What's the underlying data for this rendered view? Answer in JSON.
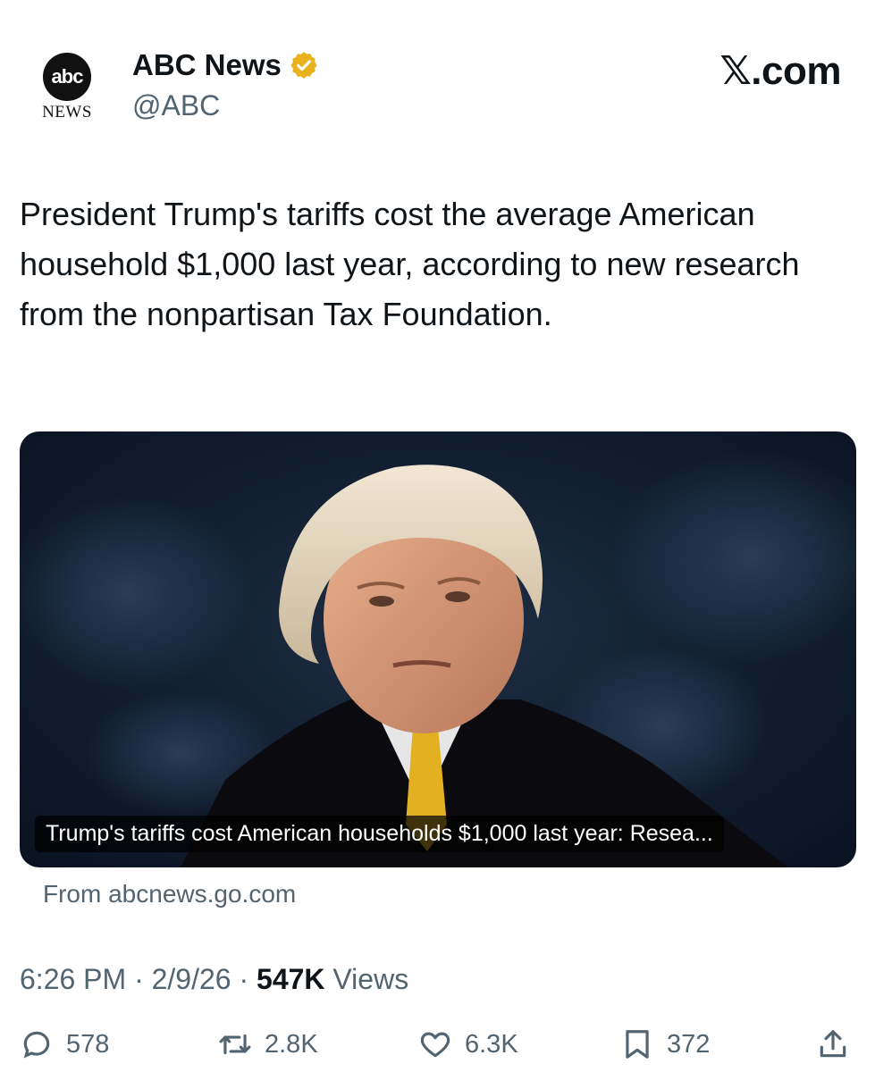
{
  "account": {
    "logo_text": "abc",
    "logo_sub": "NEWS",
    "display_name": "ABC News",
    "handle": "@ABC",
    "verified_color": "#e8b21d"
  },
  "brand": "𝕏.com",
  "tweet": {
    "text": "President Trump's tariffs cost the average American household $1,000 last year, according to new research from the nonpartisan Tax Foundation."
  },
  "card": {
    "caption": "Trump's tariffs cost American households $1,000 last year: Resea...",
    "source": "From abcnews.go.com"
  },
  "meta": {
    "time": "6:26 PM",
    "date": "2/9/26",
    "views_count": "547K",
    "views_label": "Views"
  },
  "actions": {
    "replies": "578",
    "reposts": "2.8K",
    "likes": "6.3K",
    "bookmarks": "372"
  }
}
